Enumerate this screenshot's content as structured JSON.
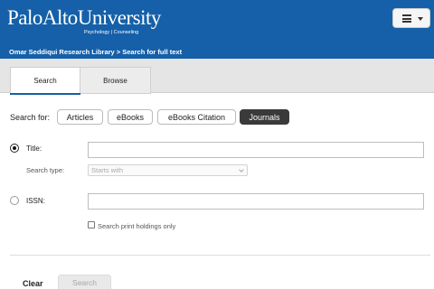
{
  "header": {
    "logo_text": "PaloAltoUniversity",
    "logo_subtitle": "Psychology | Counseling",
    "breadcrumb": "Omar Seddiqui Research Library > Search for full text",
    "menu_icon": "hamburger-icon"
  },
  "tabs": [
    {
      "label": "Search",
      "active": true
    },
    {
      "label": "Browse",
      "active": false
    }
  ],
  "search_for": {
    "label": "Search for:",
    "options": [
      {
        "label": "Articles",
        "active": false
      },
      {
        "label": "eBooks",
        "active": false
      },
      {
        "label": "eBooks Citation",
        "active": false
      },
      {
        "label": "Journals",
        "active": true
      }
    ]
  },
  "form": {
    "title_label": "Title:",
    "title_value": "",
    "search_type_label": "Search type:",
    "search_type_value": "Starts with",
    "issn_label": "ISSN:",
    "issn_value": "",
    "print_holdings_label": "Search print holdings only",
    "print_holdings_checked": false
  },
  "actions": {
    "clear_label": "Clear",
    "search_label": "Search"
  },
  "colors": {
    "brand_blue": "#1560a8",
    "active_pill": "#3a3a3a"
  }
}
